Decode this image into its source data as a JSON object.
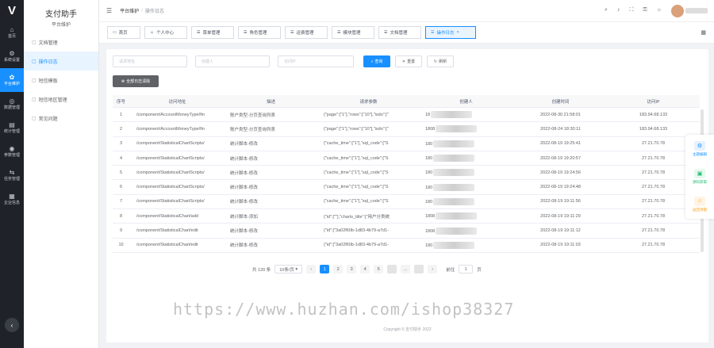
{
  "app": {
    "title": "支付助手",
    "subtitle": "平台维护",
    "logo": "V"
  },
  "rail": [
    {
      "icon": "⌂",
      "label": "首页"
    },
    {
      "icon": "⚙",
      "label": "系统设置"
    },
    {
      "icon": "✿",
      "label": "平台维护"
    },
    {
      "icon": "◎",
      "label": "数据管理"
    },
    {
      "icon": "▤",
      "label": "统计管理"
    },
    {
      "icon": "◉",
      "label": "参数管理"
    },
    {
      "icon": "⇆",
      "label": "任务管理"
    },
    {
      "icon": "▦",
      "label": "企业信息"
    }
  ],
  "submenu": [
    {
      "icon": "▢",
      "label": "文档管理"
    },
    {
      "icon": "▢",
      "label": "操作日志"
    },
    {
      "icon": "▢",
      "label": "短信模板"
    },
    {
      "icon": "▢",
      "label": "短信地区管理"
    },
    {
      "icon": "▢",
      "label": "常见问题"
    }
  ],
  "breadcrumb": {
    "parent": "平台维护",
    "sep": "/",
    "current": "操作日志"
  },
  "header_icons": [
    "⌕",
    "♪",
    "⛶",
    "⚿",
    "☼",
    "✇"
  ],
  "tabs": [
    {
      "icon": "▭",
      "label": "首页"
    },
    {
      "icon": "☺",
      "label": "个人中心"
    },
    {
      "icon": "☰",
      "label": "菜单管理"
    },
    {
      "icon": "☰",
      "label": "角色管理"
    },
    {
      "icon": "☰",
      "label": "运费管理"
    },
    {
      "icon": "☰",
      "label": "模块管理"
    },
    {
      "icon": "☰",
      "label": "文档管理"
    },
    {
      "icon": "☰",
      "label": "操作日志",
      "close": "×"
    }
  ],
  "filters": {
    "url_placeholder": "请求地址",
    "user_placeholder": "创建人",
    "ip_placeholder": "访问IP",
    "search_label": "查询",
    "reset_label": "重置",
    "refresh_label": "刷新",
    "clear_label": "全部日志清除"
  },
  "table": {
    "headers": [
      "序号",
      "访问地址",
      "描述",
      "请求参数",
      "创建人",
      "创建时间",
      "访问IP"
    ],
    "rows": [
      [
        "1",
        "/component/AccountMoneyType/fin",
        "账户类型-分页查询列表",
        "{\"page\":[\"1\"],\"rows\":[\"10\"],\"isdo\":[\"",
        "18",
        "2022-08-30 21:58:01",
        "183.94.68.133"
      ],
      [
        "2",
        "/component/AccountMoneyType/fin",
        "账户类型-分页查询列表",
        "{\"page\":[\"1\"],\"rows\":[\"10\"],\"isdo\":[\"",
        "1808",
        "2022-08-24 18:30:11",
        "183.94.68.133"
      ],
      [
        "3",
        "/component/StatisticalChartScripts/",
        "统计脚本-修改",
        "{\"cache_time\":[\"1\"],\"sql_code\":[\"S",
        "180",
        "2022-08-19 19:25:41",
        "27.21.70.78"
      ],
      [
        "4",
        "/component/StatisticalChartScripts/",
        "统计脚本-修改",
        "{\"cache_time\":[\"1\"],\"sql_code\":[\"S",
        "180",
        "2022-08-19 19:20:57",
        "27.21.70.78"
      ],
      [
        "5",
        "/component/StatisticalChartScripts/",
        "统计脚本-修改",
        "{\"cache_time\":[\"1\"],\"sql_code\":[\"S",
        "180",
        "2022-08-19 19:24:56",
        "27.21.70.78"
      ],
      [
        "6",
        "/component/StatisticalChartScripts/",
        "统计脚本-修改",
        "{\"cache_time\":[\"1\"],\"sql_code\":[\"S",
        "180",
        "2022-08-19 19:24:48",
        "27.21.70.78"
      ],
      [
        "7",
        "/component/StatisticalChartScripts/",
        "统计脚本-修改",
        "{\"cache_time\":[\"1\"],\"sql_code\":[\"S",
        "180",
        "2022-08-19 19:11:56",
        "27.21.70.78"
      ],
      [
        "8",
        "/component/StatisticalChart/add",
        "统计脚本-添加",
        "{\"id\":[\"\"],\"charts_title\":[\"用户分类统",
        "1808",
        "2022-08-19 19:11:29",
        "27.21.70.78"
      ],
      [
        "9",
        "/component/StatisticalChart/edit",
        "统计脚本-修改",
        "{\"id\":[\"3a02f60b-1d83-4b79-a7d1-",
        "1808",
        "2022-08-19 19:11:12",
        "27.21.70.78"
      ],
      [
        "10",
        "/component/StatisticalChart/edit",
        "统计脚本-修改",
        "{\"id\":[\"3a02f60b-1d83-4b79-a7d1-",
        "180",
        "2022-08-19 19:11:03",
        "27.21.70.78"
      ]
    ]
  },
  "pagination": {
    "total": "共 120 条",
    "page_size": "10条/页",
    "prev": "‹",
    "pages": [
      "1",
      "2",
      "3",
      "4",
      "5"
    ],
    "ellipsis": "...",
    "next": "›",
    "goto_label": "前往",
    "goto_value": "1",
    "page_unit": "页"
  },
  "float_panel": [
    {
      "icon": "⚙",
      "label": "主题编辑",
      "color": "#1890ff"
    },
    {
      "icon": "▣",
      "label": "源码获取",
      "color": "#19be6b"
    },
    {
      "icon": "⌂",
      "label": "返回顶部",
      "color": "#ff9900"
    }
  ],
  "watermark": "https://www.huzhan.com/ishop38327",
  "footer": "Copyright © 支付助手 2022",
  "colors": {
    "primary": "#1890ff",
    "rail_bg": "#1f2329"
  }
}
